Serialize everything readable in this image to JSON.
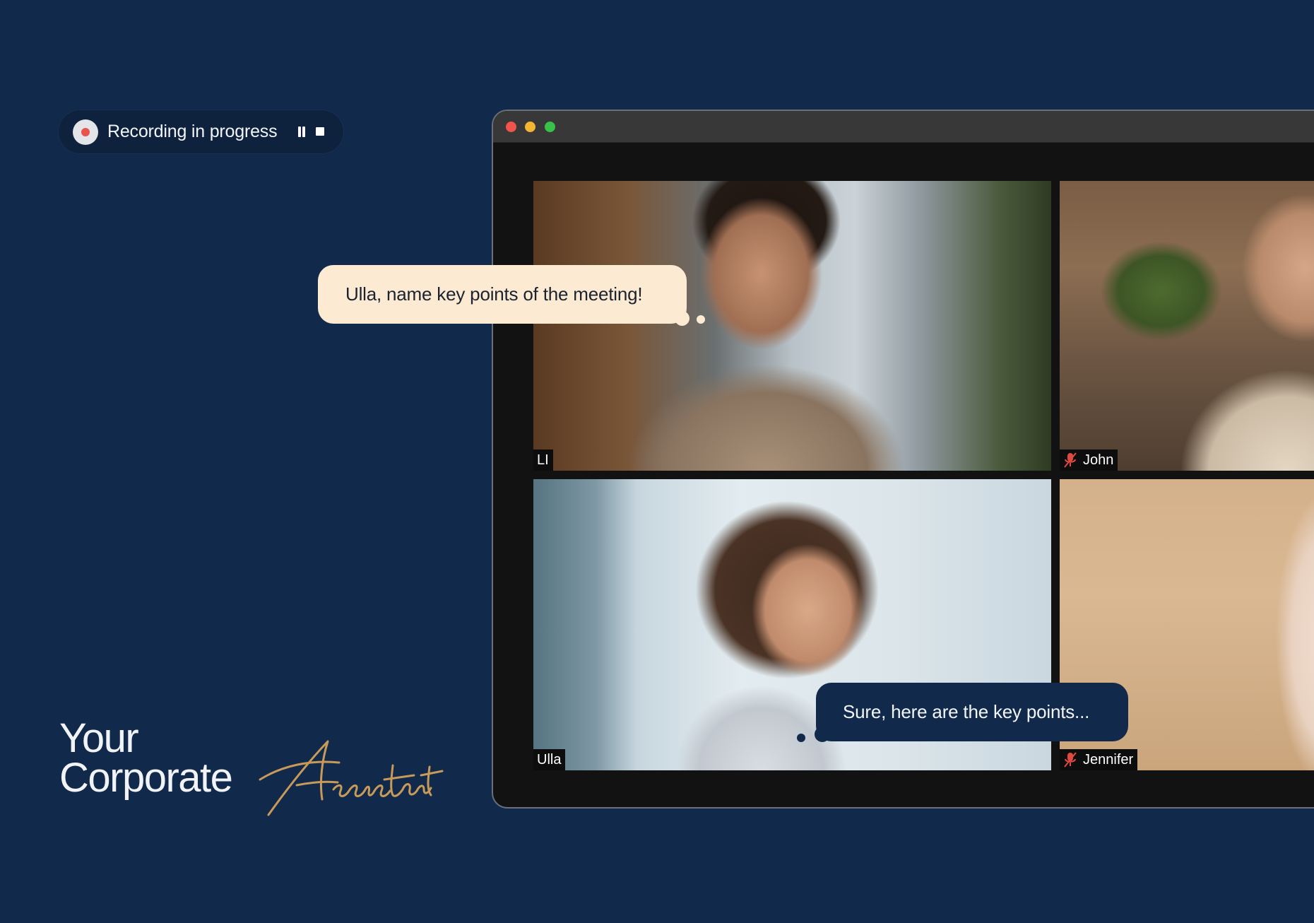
{
  "recording": {
    "label": "Recording in progress",
    "pause_icon": "pause-icon",
    "stop_icon": "stop-icon"
  },
  "tagline": {
    "line1": "Your",
    "line2": "Corporate",
    "signature": "Assistant"
  },
  "colors": {
    "background": "#11294a",
    "accent_gold": "#c79a5a",
    "user_bubble": "#fcebd2",
    "record_red": "#e8544c"
  },
  "meeting": {
    "participants": [
      {
        "name": "LI",
        "muted": false
      },
      {
        "name": "John",
        "muted": true
      },
      {
        "name": "Ulla",
        "muted": false
      },
      {
        "name": "Jennifer",
        "muted": true
      }
    ]
  },
  "chat": {
    "user_message": "Ulla, name key points of the meeting!",
    "assistant_reply": "Sure, here are the key points..."
  }
}
